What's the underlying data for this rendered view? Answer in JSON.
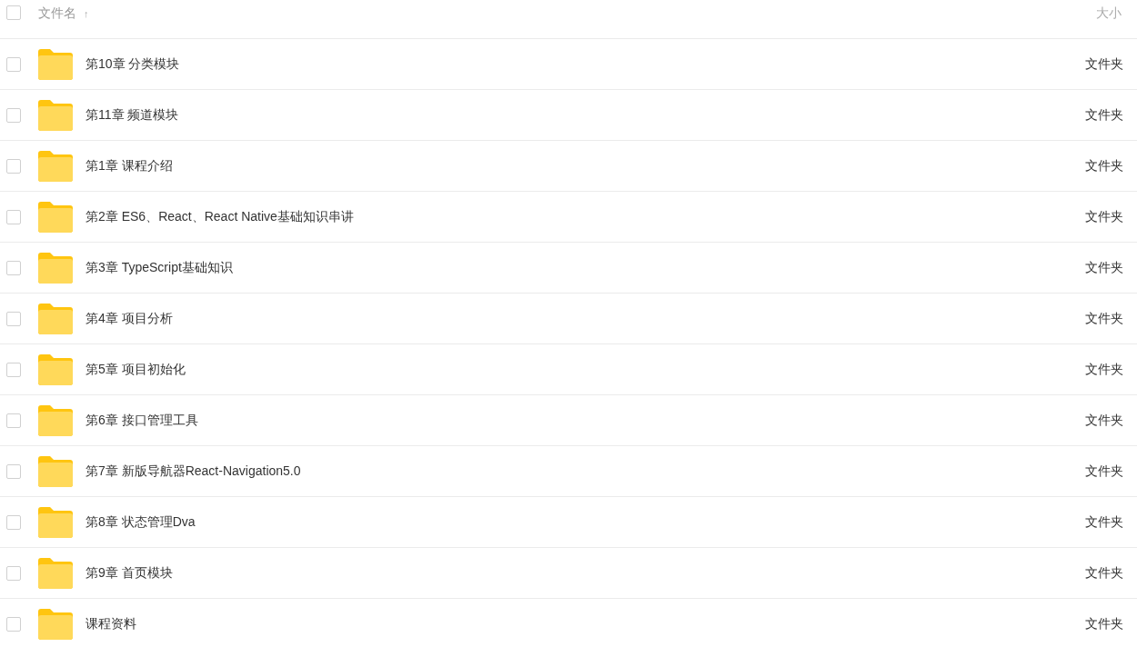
{
  "header": {
    "checked": false,
    "name_label": "文件名",
    "sort_arrow": "↑",
    "size_label": "大小"
  },
  "files": [
    {
      "name": "第10章 分类模块",
      "size": "文件夹",
      "checked": false
    },
    {
      "name": "第11章 频道模块",
      "size": "文件夹",
      "checked": false
    },
    {
      "name": "第1章 课程介绍",
      "size": "文件夹",
      "checked": false
    },
    {
      "name": "第2章 ES6、React、React Native基础知识串讲",
      "size": "文件夹",
      "checked": false
    },
    {
      "name": "第3章 TypeScript基础知识",
      "size": "文件夹",
      "checked": false
    },
    {
      "name": "第4章 项目分析",
      "size": "文件夹",
      "checked": false
    },
    {
      "name": "第5章 项目初始化",
      "size": "文件夹",
      "checked": false
    },
    {
      "name": "第6章 接口管理工具",
      "size": "文件夹",
      "checked": false
    },
    {
      "name": "第7章 新版导航器React-Navigation5.0",
      "size": "文件夹",
      "checked": false
    },
    {
      "name": "第8章 状态管理Dva",
      "size": "文件夹",
      "checked": false
    },
    {
      "name": "第9章 首页模块",
      "size": "文件夹",
      "checked": false
    },
    {
      "name": "课程资料",
      "size": "文件夹",
      "checked": false
    }
  ]
}
